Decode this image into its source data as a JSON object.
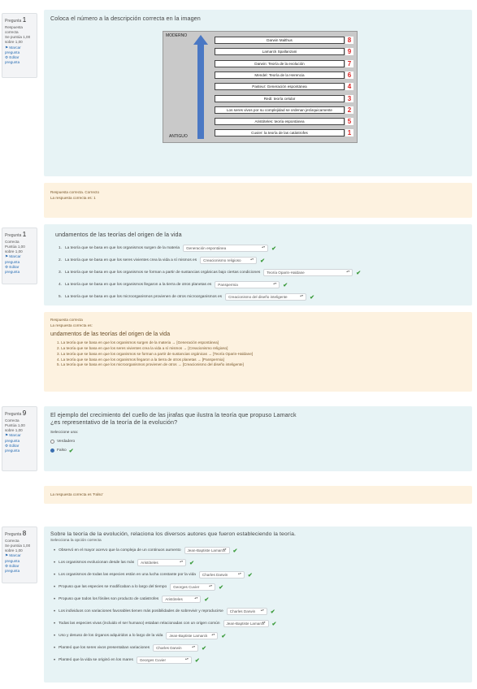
{
  "q1": {
    "info": {
      "label": "Pregunta",
      "number": "1",
      "status": "Respuesta correcta",
      "score": "Se puntúa 1,00 sobre 1,00",
      "flag": "Marcar pregunta",
      "edit": "Editar pregunta"
    },
    "text": "Coloca el número a la descripción correcta en la imagen",
    "figure": {
      "top_label": "MODERNO",
      "bottom_label": "ANTIGUO",
      "boxes": [
        {
          "text": "Darwin Malthus",
          "num": "8"
        },
        {
          "text": "Lamarck Spallanzani",
          "num": "9"
        },
        {
          "text": "Darwin: Teoría de la evolución",
          "num": "7"
        },
        {
          "text": "Mendel: Teoría de la Herencia",
          "num": "6"
        },
        {
          "text": "Pasteur: Generación espontánea",
          "num": "4"
        },
        {
          "text": "Redi: teoría celular",
          "num": "3"
        },
        {
          "text": "Los seres vivos por su complejidad se ordenan jerárquicamente",
          "num": "2"
        },
        {
          "text": "Aristóteles: teoría espontánea",
          "num": "5"
        },
        {
          "text": "Cuvier: la teoría de las catástrofes",
          "num": "1"
        }
      ],
      "arrow_color": "#4a78c4"
    },
    "feedback": {
      "title": "Respuesta",
      "line1": "Respuesta correcta. Correcto",
      "line2": "La respuesta correcta es: 1"
    }
  },
  "q2": {
    "info": {
      "label": "Pregunta",
      "number": "1",
      "status": "Correcta",
      "score": "Puntúa 1,00 sobre 1,00",
      "flag": "Marcar pregunta",
      "edit": "Editar pregunta"
    },
    "text": "undamentos de las teorías del origen de la vida",
    "items": [
      {
        "n": "1.",
        "text": "La teoría que se basa en que los organismos surgen de la materia",
        "select": "Generación espontánea"
      },
      {
        "n": "2.",
        "text": "La teoría que se basa en que los seres vivientes crea la vida a sí mismos es",
        "select": "Creacionismo religioso"
      },
      {
        "n": "3.",
        "text": "La teoría que se basa en que los organismos se forman a partir de sustancias orgánicas bajo ciertas condiciones",
        "select": "Teoría Oparin-Haldane"
      },
      {
        "n": "4.",
        "text": "La teoría que se basa en que los organismos llegaron a la tierra de otros planetas es",
        "select": "Panspermia"
      },
      {
        "n": "5.",
        "text": "La teoría que se basa en que los microorganismos provienen de otros microorganismos es",
        "select": "Creacionismo del diseño inteligente"
      }
    ],
    "feedback": {
      "title": "Respuesta correcta",
      "intro": "La respuesta correcta es:",
      "heading": "undamentos de las teorías del origen de la vida",
      "lines": [
        "1. La teoría que se basa en que los organismos surgen de la materia → [Generación espontánea]",
        "2. La teoría que se basa en que los seres vivientes crea la vida a sí mismos → [Creacionismo religioso]",
        "3. La teoría que se basa en que los organismos se forman a partir de sustancias orgánicas → [Teoría Oparin-Haldane]",
        "4. La teoría que se basa en que los organismos llegaron a la tierra de otros planetas → [Panspermia]",
        "5. La teoría que se basa en que los microorganismos provienen de otros → [Creacionismo del diseño inteligente]"
      ]
    }
  },
  "q3": {
    "info": {
      "label": "Pregunta",
      "number": "9",
      "status": "Correcta",
      "score": "Puntúa 1,00 sobre 1,00",
      "flag": "Marcar pregunta",
      "edit": "Editar pregunta"
    },
    "text": "El ejemplo del crecimiento del cuello de las jirafas que ilustra la teoría que propuso Lamarck",
    "text2": "¿es representativo de la teoría de la evolución?",
    "prompt": "Seleccione una:",
    "options": [
      "Verdadero",
      "Falso"
    ],
    "feedback": "La respuesta correcta es 'Falso'"
  },
  "q4": {
    "info": {
      "label": "Pregunta",
      "number": "8",
      "status": "Correcta",
      "score": "Se puntúa 1,00 sobre 1,00",
      "flag": "Marcar pregunta",
      "edit": "Editar pregunta"
    },
    "text": "Sobre la teoría de la evolución, relaciona los diversos autores que fueron estableciendo la teoría.",
    "subtitle": "Selecciona la opción correcta",
    "items": [
      {
        "text": "Observó en el mayor acervo que la compleja de un continuos aumento",
        "select": "Jean-Baptiste Lamarck"
      },
      {
        "text": "Los organismos evolucionan desde las más",
        "select": "Aristóteles"
      },
      {
        "text": "Los organismos de todas las especies están en una lucha constante por la vida",
        "select": "Charles Darwin"
      },
      {
        "text": "Propuso que las especies se modificaban a lo largo del tiempo",
        "select": "Georges Cuvier"
      },
      {
        "text": "Propuso que todos los fósiles son producto de catástrofes",
        "select": "Aristóteles"
      },
      {
        "text": "Los individuos con variaciones favorables tienen más posibilidades de sobrevivir y reproducirse",
        "select": "Charles Darwin"
      },
      {
        "text": "Todas las especies vivas (incluido el ser humano) estaban relacionadas con un origen común",
        "select": "Jean-Baptiste Lamarck"
      },
      {
        "text": "Uso y desuso de los órganos adquiridos a lo largo de la vida",
        "select": "Jean-Baptiste Lamarck"
      },
      {
        "text": "Planteó que los seres vivos presentaban variaciones",
        "select": "Charles Darwin"
      },
      {
        "text": "Planteó que la vida se originó en los mares",
        "select": "Georges Cuvier"
      }
    ]
  }
}
